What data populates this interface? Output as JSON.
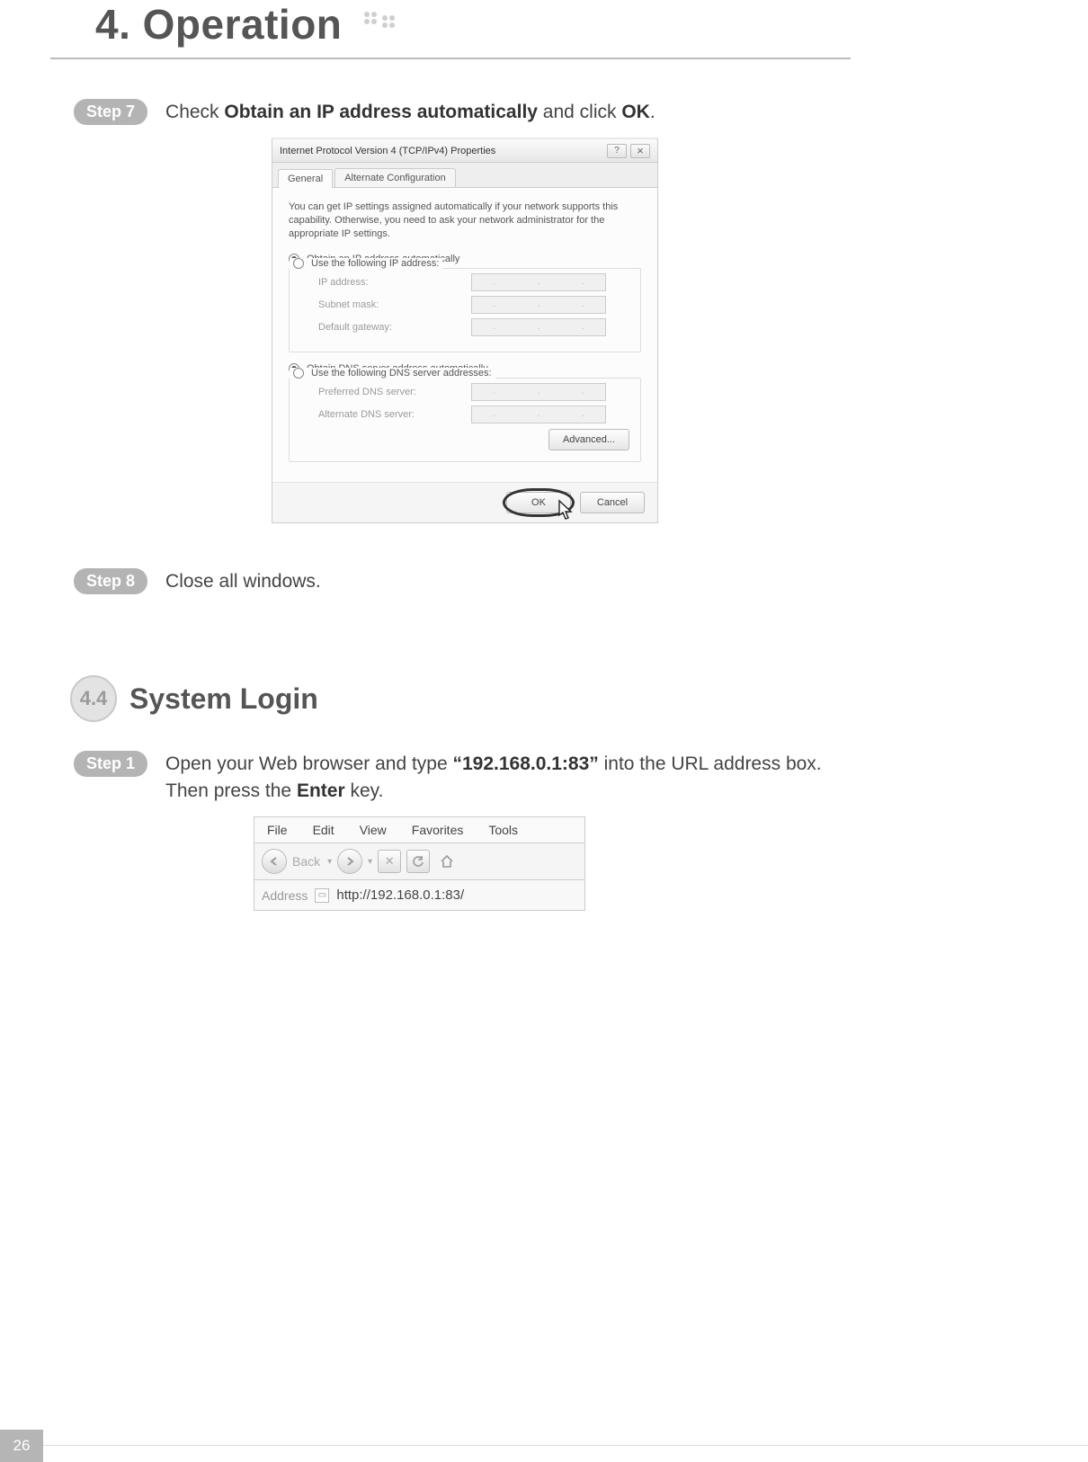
{
  "chapter_title": "4. Operation",
  "page_number": "26",
  "step7": {
    "label": "Step 7",
    "text_pre": "Check ",
    "bold1": "Obtain an IP address automatically",
    "text_mid": " and click ",
    "bold2": "OK",
    "text_post": "."
  },
  "dialog": {
    "title": "Internet Protocol Version 4 (TCP/IPv4) Properties",
    "tab_general": "General",
    "tab_alt": "Alternate Configuration",
    "helptext": "You can get IP settings assigned automatically if your network supports this capability. Otherwise, you need to ask your network administrator for the appropriate IP settings.",
    "radio_auto_ip": "Obtain an IP address automatically",
    "radio_manual_ip": "Use the following IP address:",
    "lbl_ip": "IP address:",
    "lbl_subnet": "Subnet mask:",
    "lbl_gw": "Default gateway:",
    "radio_auto_dns": "Obtain DNS server address automatically",
    "radio_manual_dns": "Use the following DNS server addresses:",
    "lbl_pref_dns": "Preferred DNS server:",
    "lbl_alt_dns": "Alternate DNS server:",
    "btn_adv": "Advanced...",
    "btn_ok": "OK",
    "btn_cancel": "Cancel"
  },
  "step8": {
    "label": "Step 8",
    "text": "Close all windows."
  },
  "section": {
    "num": "4.4",
    "title": "System Login"
  },
  "step1": {
    "label": "Step 1",
    "text_pre": "Open your Web browser and type ",
    "bold1": "“192.168.0.1:83”",
    "text_mid": " into the URL address box. Then press the ",
    "bold2": "Enter",
    "text_post": " key."
  },
  "browser": {
    "menu": {
      "file": "File",
      "edit": "Edit",
      "view": "View",
      "favorites": "Favorites",
      "tools": "Tools"
    },
    "back_label": "Back",
    "address_label": "Address",
    "url": "http://192.168.0.1:83/"
  }
}
